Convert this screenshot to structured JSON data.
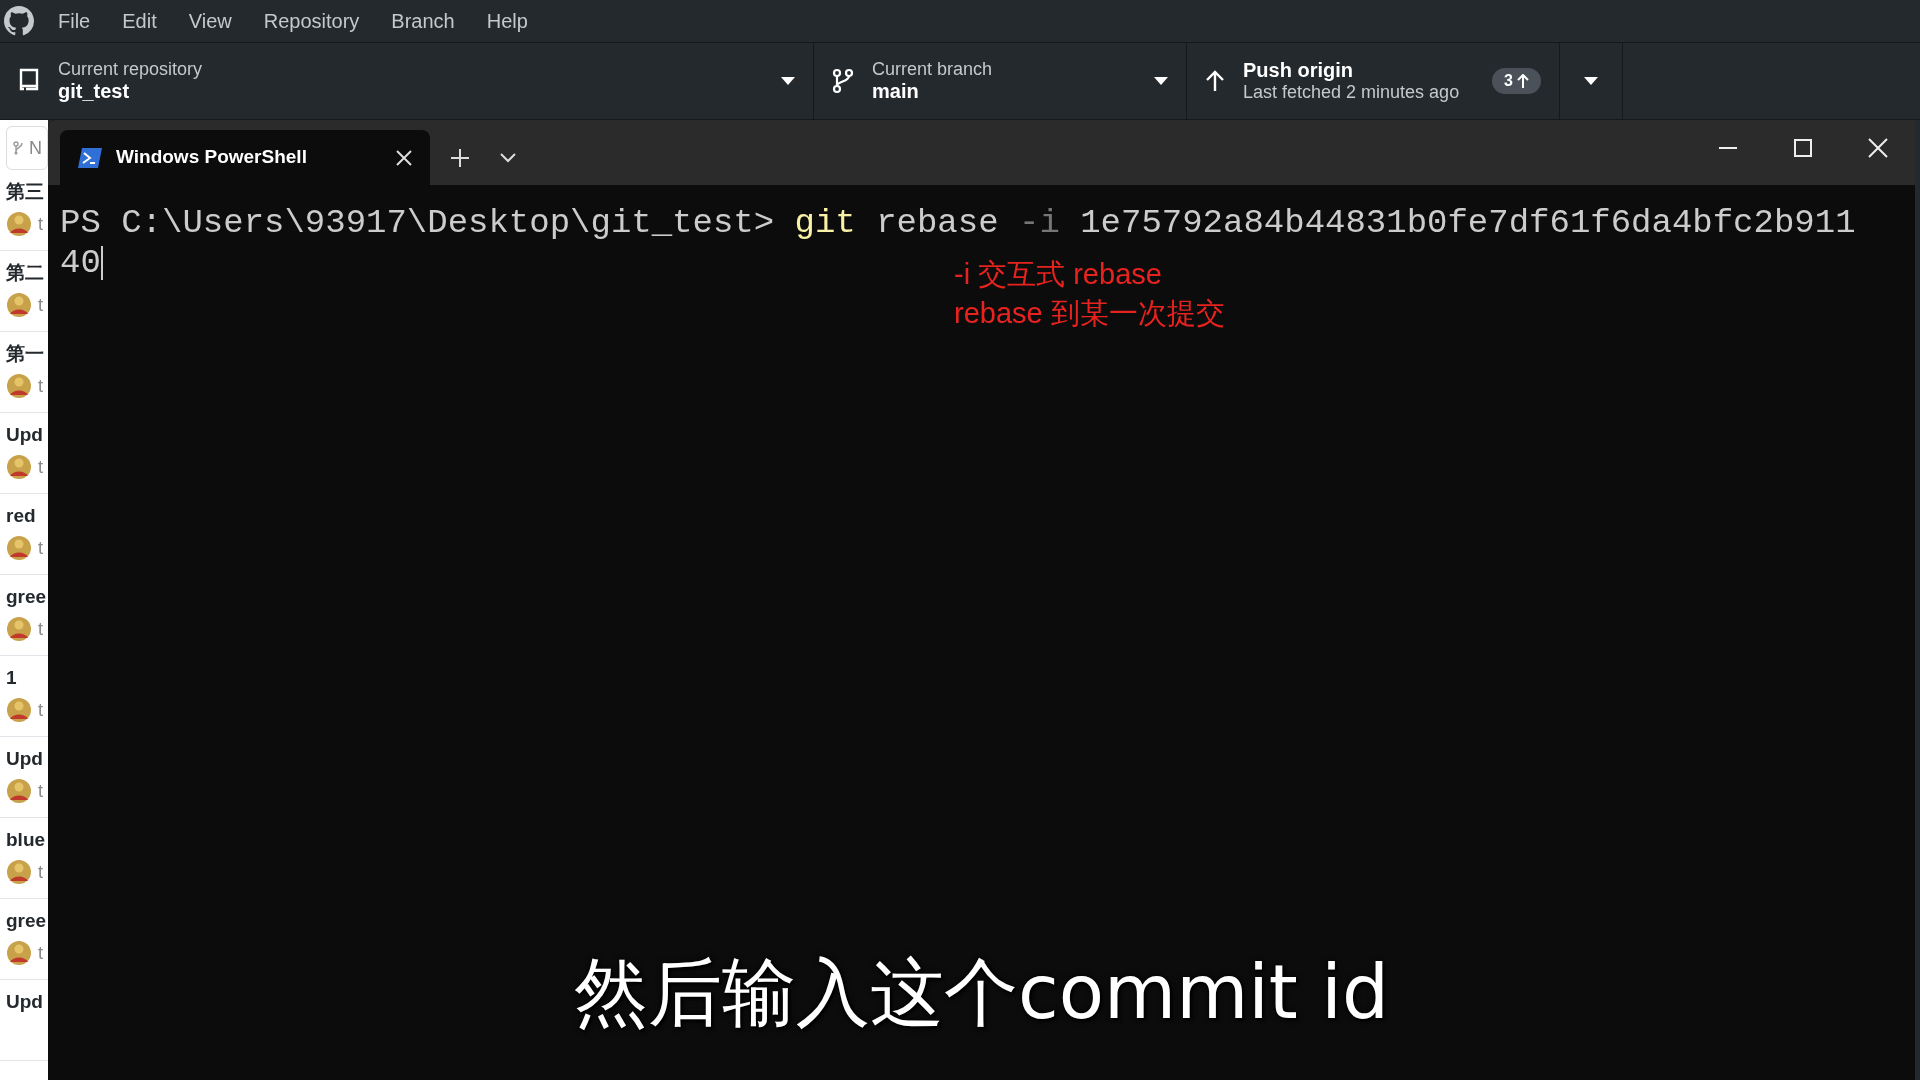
{
  "menu": [
    "File",
    "Edit",
    "View",
    "Repository",
    "Branch",
    "Help"
  ],
  "toolbar": {
    "repository": {
      "label": "Current repository",
      "value": "git_test"
    },
    "branch": {
      "label": "Current branch",
      "value": "main"
    },
    "push": {
      "title": "Push origin",
      "subtitle": "Last fetched 2 minutes ago",
      "badge": "3"
    }
  },
  "sidebar": {
    "branch_filter": "N",
    "commits": [
      {
        "title": "第三",
        "author": "t"
      },
      {
        "title": "第二",
        "author": "t"
      },
      {
        "title": "第一",
        "author": "t"
      },
      {
        "title": "Upd",
        "author": "t"
      },
      {
        "title": "red",
        "author": "t"
      },
      {
        "title": "gree",
        "author": "t"
      },
      {
        "title": "1",
        "author": "t"
      },
      {
        "title": "Upd",
        "author": "t"
      },
      {
        "title": "blue",
        "author": "t"
      },
      {
        "title": "gree",
        "author": "t"
      },
      {
        "title": "Upd"
      }
    ]
  },
  "terminal": {
    "tabs": [
      {
        "title": "Windows PowerShell",
        "selected": true
      }
    ],
    "prompt": "PS C:\\Users\\93917\\Desktop\\git_test>",
    "command": [
      {
        "kind": "program",
        "text": "git"
      },
      {
        "kind": "arg",
        "text": "rebase"
      },
      {
        "kind": "flag",
        "text": "-i"
      },
      {
        "kind": "arg",
        "text": "1e75792a84b44831b0fe7df61f6da4bfc2b911"
      }
    ],
    "continuation": "40"
  },
  "annotation": [
    "-i 交互式 rebase",
    "rebase 到某一次提交"
  ],
  "subtitle": "然后输入这个commit id"
}
